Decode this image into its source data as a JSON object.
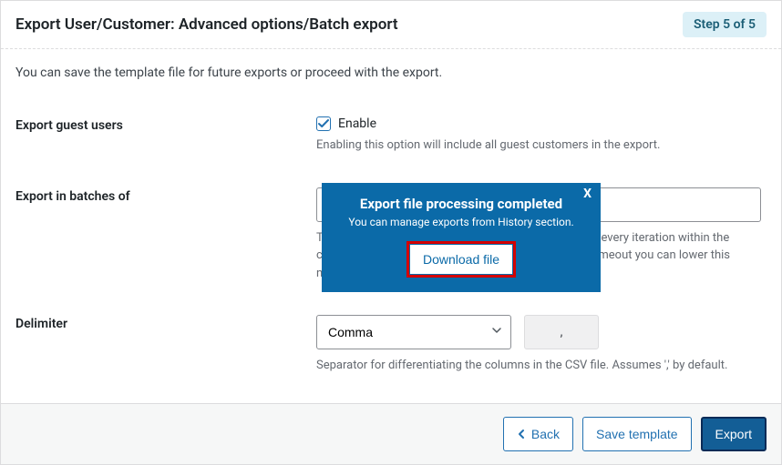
{
  "header": {
    "title": "Export User/Customer: Advanced options/Batch export",
    "step_badge": "Step 5 of 5"
  },
  "intro": "You can save the template file for future exports or proceed with the export.",
  "fields": {
    "guest": {
      "label": "Export guest users",
      "enable_label": "Enable",
      "help": "Enabling this option will include all guest customers in the export."
    },
    "batches": {
      "label": "Export in batches of",
      "help": "The number of records that the server will process for every iteration within the configured timeout interval. If the export fails due to timeout you can lower this number accordingly and try again"
    },
    "delimiter": {
      "label": "Delimiter",
      "selected": "Comma",
      "char": ",",
      "help": "Separator for differentiating the columns in the CSV file. Assumes ',' by default."
    }
  },
  "footer": {
    "back": "Back",
    "save_template": "Save template",
    "export": "Export"
  },
  "popup": {
    "close": "X",
    "title": "Export file processing completed",
    "subtitle": "You can manage exports from History section.",
    "download": "Download file"
  }
}
